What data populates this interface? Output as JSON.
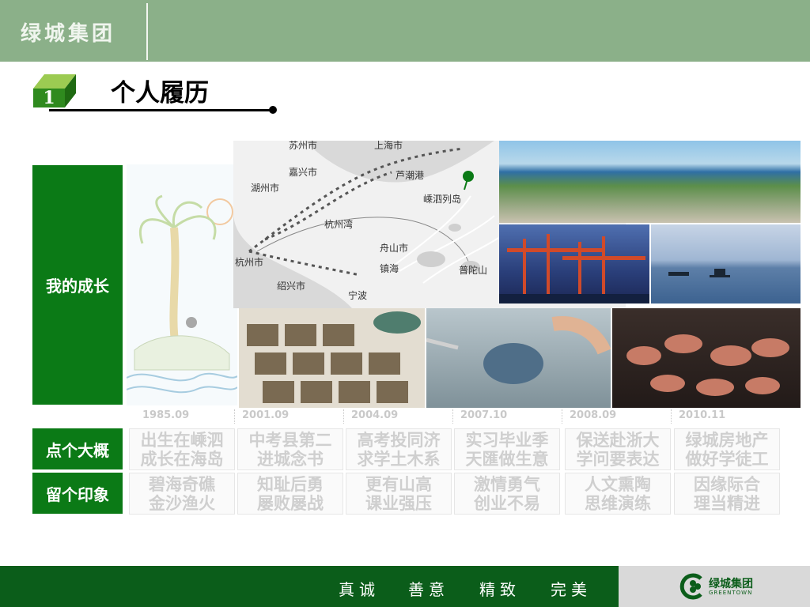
{
  "header": {
    "brand": "绿城集团"
  },
  "section": {
    "number": "1",
    "title": "个人履历"
  },
  "rows": {
    "growth": "我的成长",
    "overview": "点个大概",
    "impression": "留个印象"
  },
  "map": {
    "labels": [
      "苏州市",
      "上海市",
      "嘉兴市",
      "芦潮港",
      "湖州市",
      "嵊泗列岛",
      "杭州湾",
      "舟山市",
      "杭州市",
      "镇海",
      "普陀山",
      "绍兴市",
      "宁波"
    ]
  },
  "timeline": [
    {
      "year": "1985.09",
      "overview": [
        "出生在嵊泗",
        "成长在海岛"
      ],
      "impression": [
        "碧海奇礁",
        "金沙渔火"
      ]
    },
    {
      "year": "2001.09",
      "overview": [
        "中考县第二",
        "进城念书"
      ],
      "impression": [
        "知耻后勇",
        "屡败屡战"
      ]
    },
    {
      "year": "2004.09",
      "overview": [
        "高考投同济",
        "求学土木系"
      ],
      "impression": [
        "更有山高",
        "课业强压"
      ]
    },
    {
      "year": "2007.10",
      "overview": [
        "实习毕业季",
        "天匯做生意"
      ],
      "impression": [
        "激情勇气",
        "创业不易"
      ]
    },
    {
      "year": "2008.09",
      "overview": [
        "保送赴浙大",
        "学问要表达"
      ],
      "impression": [
        "人文熏陶",
        "思维演练"
      ]
    },
    {
      "year": "2010.11",
      "overview": [
        "绿城房地产",
        "做好学徒工"
      ],
      "impression": [
        "因缘际合",
        "理当精进"
      ]
    }
  ],
  "footer": {
    "slogans": [
      "真诚",
      "善意",
      "精致",
      "完美"
    ],
    "logo_text": "绿城集团",
    "logo_sub": "GREENTOWN"
  },
  "colors": {
    "header": "#8bb089",
    "label_green": "#0b7a16",
    "footer_green": "#0b5d1a"
  }
}
